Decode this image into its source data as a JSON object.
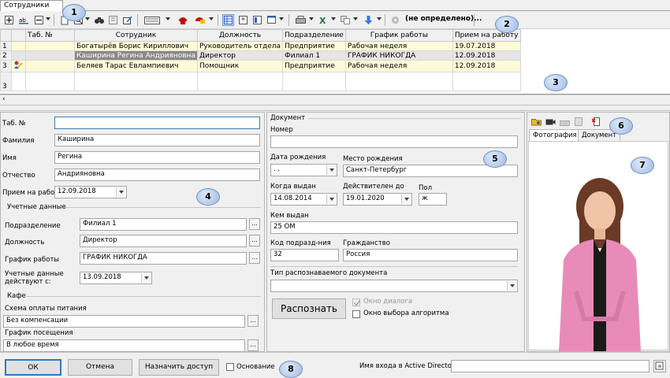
{
  "tab": {
    "title": "Сотрудники"
  },
  "toolbar": {
    "filter_text": "(не определено)...",
    "icons": [
      "add-icon",
      "abl-icon",
      "remove-icon",
      "copy-icon",
      "search-icon",
      "binoculars-icon",
      "select-icon",
      "edit-icon",
      "wide-icon",
      "phone-icon",
      "card-icon",
      "grid-icon",
      "photo-icon",
      "export-icon",
      "print-icon",
      "excel-icon",
      "copy2-icon",
      "download-icon",
      "settings-icon"
    ]
  },
  "grid": {
    "columns": [
      "Таб. №",
      "Сотрудник",
      "Должность",
      "Подразделение",
      "График работы",
      "Прием на работу"
    ],
    "rows": [
      {
        "num": "1",
        "tab": "",
        "employee": "Богатырёв Борис Кириллович",
        "position": "Руководитель отдела",
        "department": "Предприятие",
        "schedule": "Рабочая неделя",
        "hired": "19.07.2018"
      },
      {
        "num": "2",
        "tab": "",
        "employee": "Каширина Регина Андрияновна",
        "position": "Директор",
        "department": "Филиал 1",
        "schedule": "ГРАФИК НИКОГДА",
        "hired": "12.09.2018"
      },
      {
        "num": "3",
        "tab": "",
        "employee": "Беляев Тарас Евлампиевич",
        "position": "Помощник",
        "department": "Предприятие",
        "schedule": "Рабочая неделя",
        "hired": "12.09.2018"
      }
    ],
    "footer_num": "3"
  },
  "left": {
    "tab_label": "Таб. №",
    "tab_value": "",
    "surname_label": "Фамилия",
    "surname_value": "Каширина",
    "name_label": "Имя",
    "name_value": "Регина",
    "patronymic_label": "Отчество",
    "patronymic_value": "Андрияновна",
    "hire_label": "Прием на работу",
    "hire_value": "12.09.2018",
    "accounts_title": "Учетные данные",
    "dept_label": "Подразделение",
    "dept_value": "Филиал 1",
    "position_label": "Должность",
    "position_value": "Директор",
    "schedule_label": "График работы",
    "schedule_value": "ГРАФИК НИКОГДА",
    "valid_label_1": "Учетные данные",
    "valid_label_2": "действуют с:",
    "valid_value": "13.09.2018",
    "cafe_title": "Кафе",
    "meal_label": "Схема оплаты питания",
    "meal_value": "Без компенсации",
    "visit_label": "График посещения",
    "visit_value": "В любое время"
  },
  "document": {
    "title": "Документ",
    "number_label": "Номер",
    "number_value": "",
    "birthdate_label": "Дата рождения",
    "birthdate_value": ". .",
    "birthplace_label": "Место рождения",
    "birthplace_value": "Санкт-Петербург",
    "issued_label": "Когда выдан",
    "issued_value": "14.08.2014",
    "valid_label": "Действителен до",
    "valid_value": "19.01.2020",
    "sex_label": "Пол",
    "sex_value": "ж",
    "issuer_label": "Кем выдан",
    "issuer_value": "25 ОМ",
    "code_label": "Код подразд-ния",
    "code_value": "32",
    "citizenship_label": "Гражданство",
    "citizenship_value": "Россия",
    "doctype_label": "Тип распознаваемого документа",
    "doctype_value": "",
    "recognize_label": "Распознать",
    "dialog_label": "Окно диалога",
    "algo_label": "Окно выбора алгоритма"
  },
  "photo": {
    "tab_photo": "Фотография",
    "tab_doc": "Документ"
  },
  "footer": {
    "ok": "ОК",
    "cancel": "Отмена",
    "assign": "Назначить доступ",
    "basis": "Основание",
    "ad_label": "Имя входа в Active Directory",
    "ad_value": ""
  },
  "callouts": [
    "1",
    "2",
    "3",
    "4",
    "5",
    "6",
    "7",
    "8"
  ],
  "colors": {
    "row_highlight": "#fdfbd8",
    "selected": "#8a8a8a",
    "callout": "#9fbbe2"
  }
}
